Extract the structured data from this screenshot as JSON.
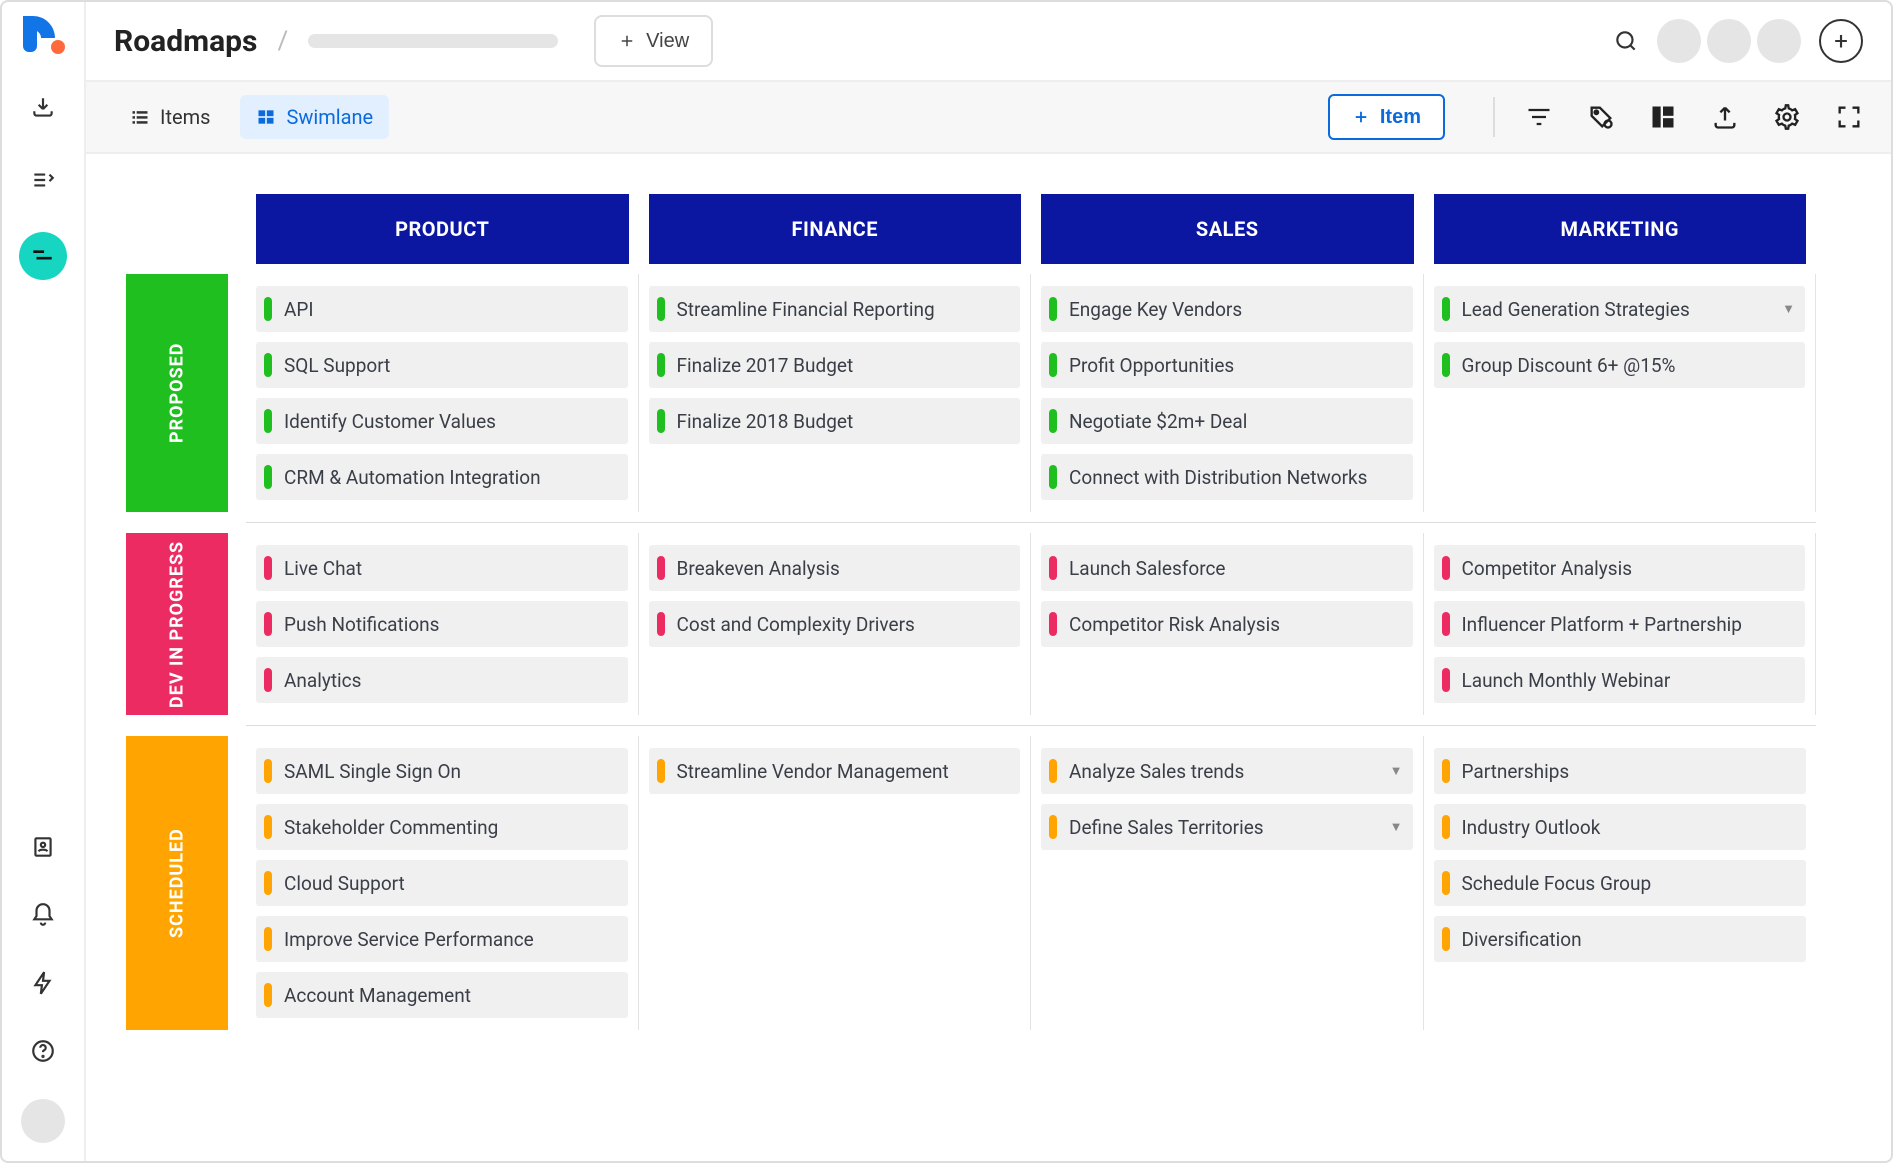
{
  "colors": {
    "green": "#1fbf1f",
    "pink": "#ec2b62",
    "orange": "#ffa400",
    "navy": "#0b17a1",
    "blue": "#0b6bdd"
  },
  "header": {
    "title": "Roadmaps",
    "view_button": "View",
    "add_avatar_label": "+"
  },
  "toolbar": {
    "items_label": "Items",
    "swimlane_label": "Swimlane",
    "new_item_label": "Item"
  },
  "columns": [
    "PRODUCT",
    "FINANCE",
    "SALES",
    "MARKETING"
  ],
  "lanes": [
    {
      "id": "proposed",
      "label": "PROPOSED",
      "color": "green",
      "cells": [
        [
          "API",
          "SQL Support",
          "Identify Customer Values",
          "CRM & Automation Integration"
        ],
        [
          "Streamline Financial Reporting",
          "Finalize 2017 Budget",
          "Finalize 2018 Budget"
        ],
        [
          "Engage Key Vendors",
          "Profit Opportunities",
          "Negotiate $2m+ Deal",
          "Connect with Distribution Networks"
        ],
        [
          {
            "text": "Lead Generation Strategies",
            "caret": true
          },
          "Group Discount 6+ @15%"
        ]
      ]
    },
    {
      "id": "dev",
      "label": "DEV IN PROGRESS",
      "color": "pink",
      "cells": [
        [
          "Live Chat",
          "Push Notifications",
          "Analytics"
        ],
        [
          "Breakeven Analysis",
          "Cost and Complexity Drivers"
        ],
        [
          "Launch Salesforce",
          "Competitor Risk Analysis"
        ],
        [
          "Competitor Analysis",
          "Influencer Platform + Partnership",
          "Launch Monthly Webinar"
        ]
      ]
    },
    {
      "id": "scheduled",
      "label": "SCHEDULED",
      "color": "orange",
      "cells": [
        [
          "SAML Single Sign On",
          "Stakeholder Commenting",
          "Cloud Support",
          "Improve Service Performance",
          "Account Management"
        ],
        [
          "Streamline Vendor Management"
        ],
        [
          {
            "text": "Analyze Sales trends",
            "caret": true
          },
          {
            "text": "Define Sales Territories",
            "caret": true
          }
        ],
        [
          "Partnerships",
          "Industry Outlook",
          "Schedule Focus Group",
          "Diversification"
        ]
      ]
    }
  ]
}
